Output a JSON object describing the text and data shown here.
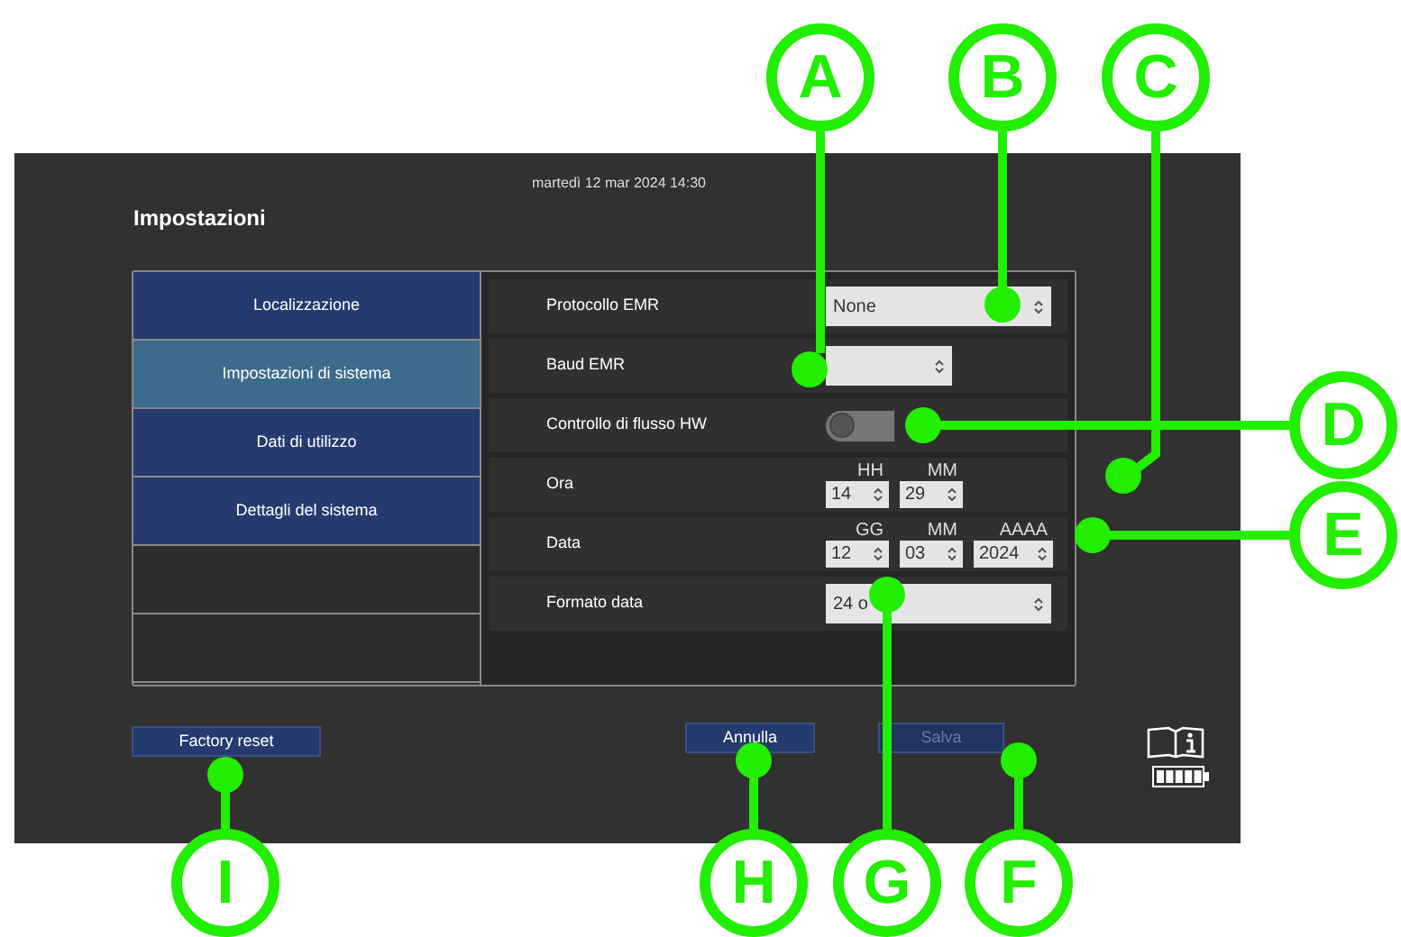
{
  "screen": {
    "datetime": "martedì 12 mar 2024 14:30",
    "title": "Impostazioni"
  },
  "sidebar": {
    "items": [
      {
        "label": "Localizzazione",
        "selected": false
      },
      {
        "label": "Impostazioni di sistema",
        "selected": true
      },
      {
        "label": "Dati di utilizzo",
        "selected": false
      },
      {
        "label": "Dettagli del sistema",
        "selected": false
      },
      {
        "selected": false
      },
      {
        "selected": false
      }
    ]
  },
  "settings": [
    {
      "kind": "select",
      "label": "Protocollo EMR",
      "value": "None",
      "wide": true
    },
    {
      "kind": "select",
      "label": "Baud EMR",
      "wide": false
    },
    {
      "kind": "toggle",
      "label": "Controllo di flusso HW",
      "on": false
    },
    {
      "kind": "spinners",
      "label": "Ora",
      "fields": [
        {
          "caption": "HH",
          "value": "14"
        },
        {
          "caption": "MM",
          "value": "29"
        }
      ]
    },
    {
      "kind": "spinners",
      "label": "Data",
      "fields": [
        {
          "caption": "GG",
          "value": "12"
        },
        {
          "caption": "MM",
          "value": "03"
        },
        {
          "caption": "AAAA",
          "value": "2024"
        }
      ]
    },
    {
      "kind": "select",
      "label": "Formato data",
      "value": "24 o",
      "wide": true
    }
  ],
  "buttons": [
    {
      "label": "Factory reset",
      "disabled": false
    },
    {
      "label": "Annulla",
      "disabled": false
    },
    {
      "label": "Salva",
      "disabled": true
    }
  ],
  "callouts": [
    "A",
    "B",
    "C",
    "D",
    "E",
    "I",
    "H",
    "G",
    "F"
  ]
}
